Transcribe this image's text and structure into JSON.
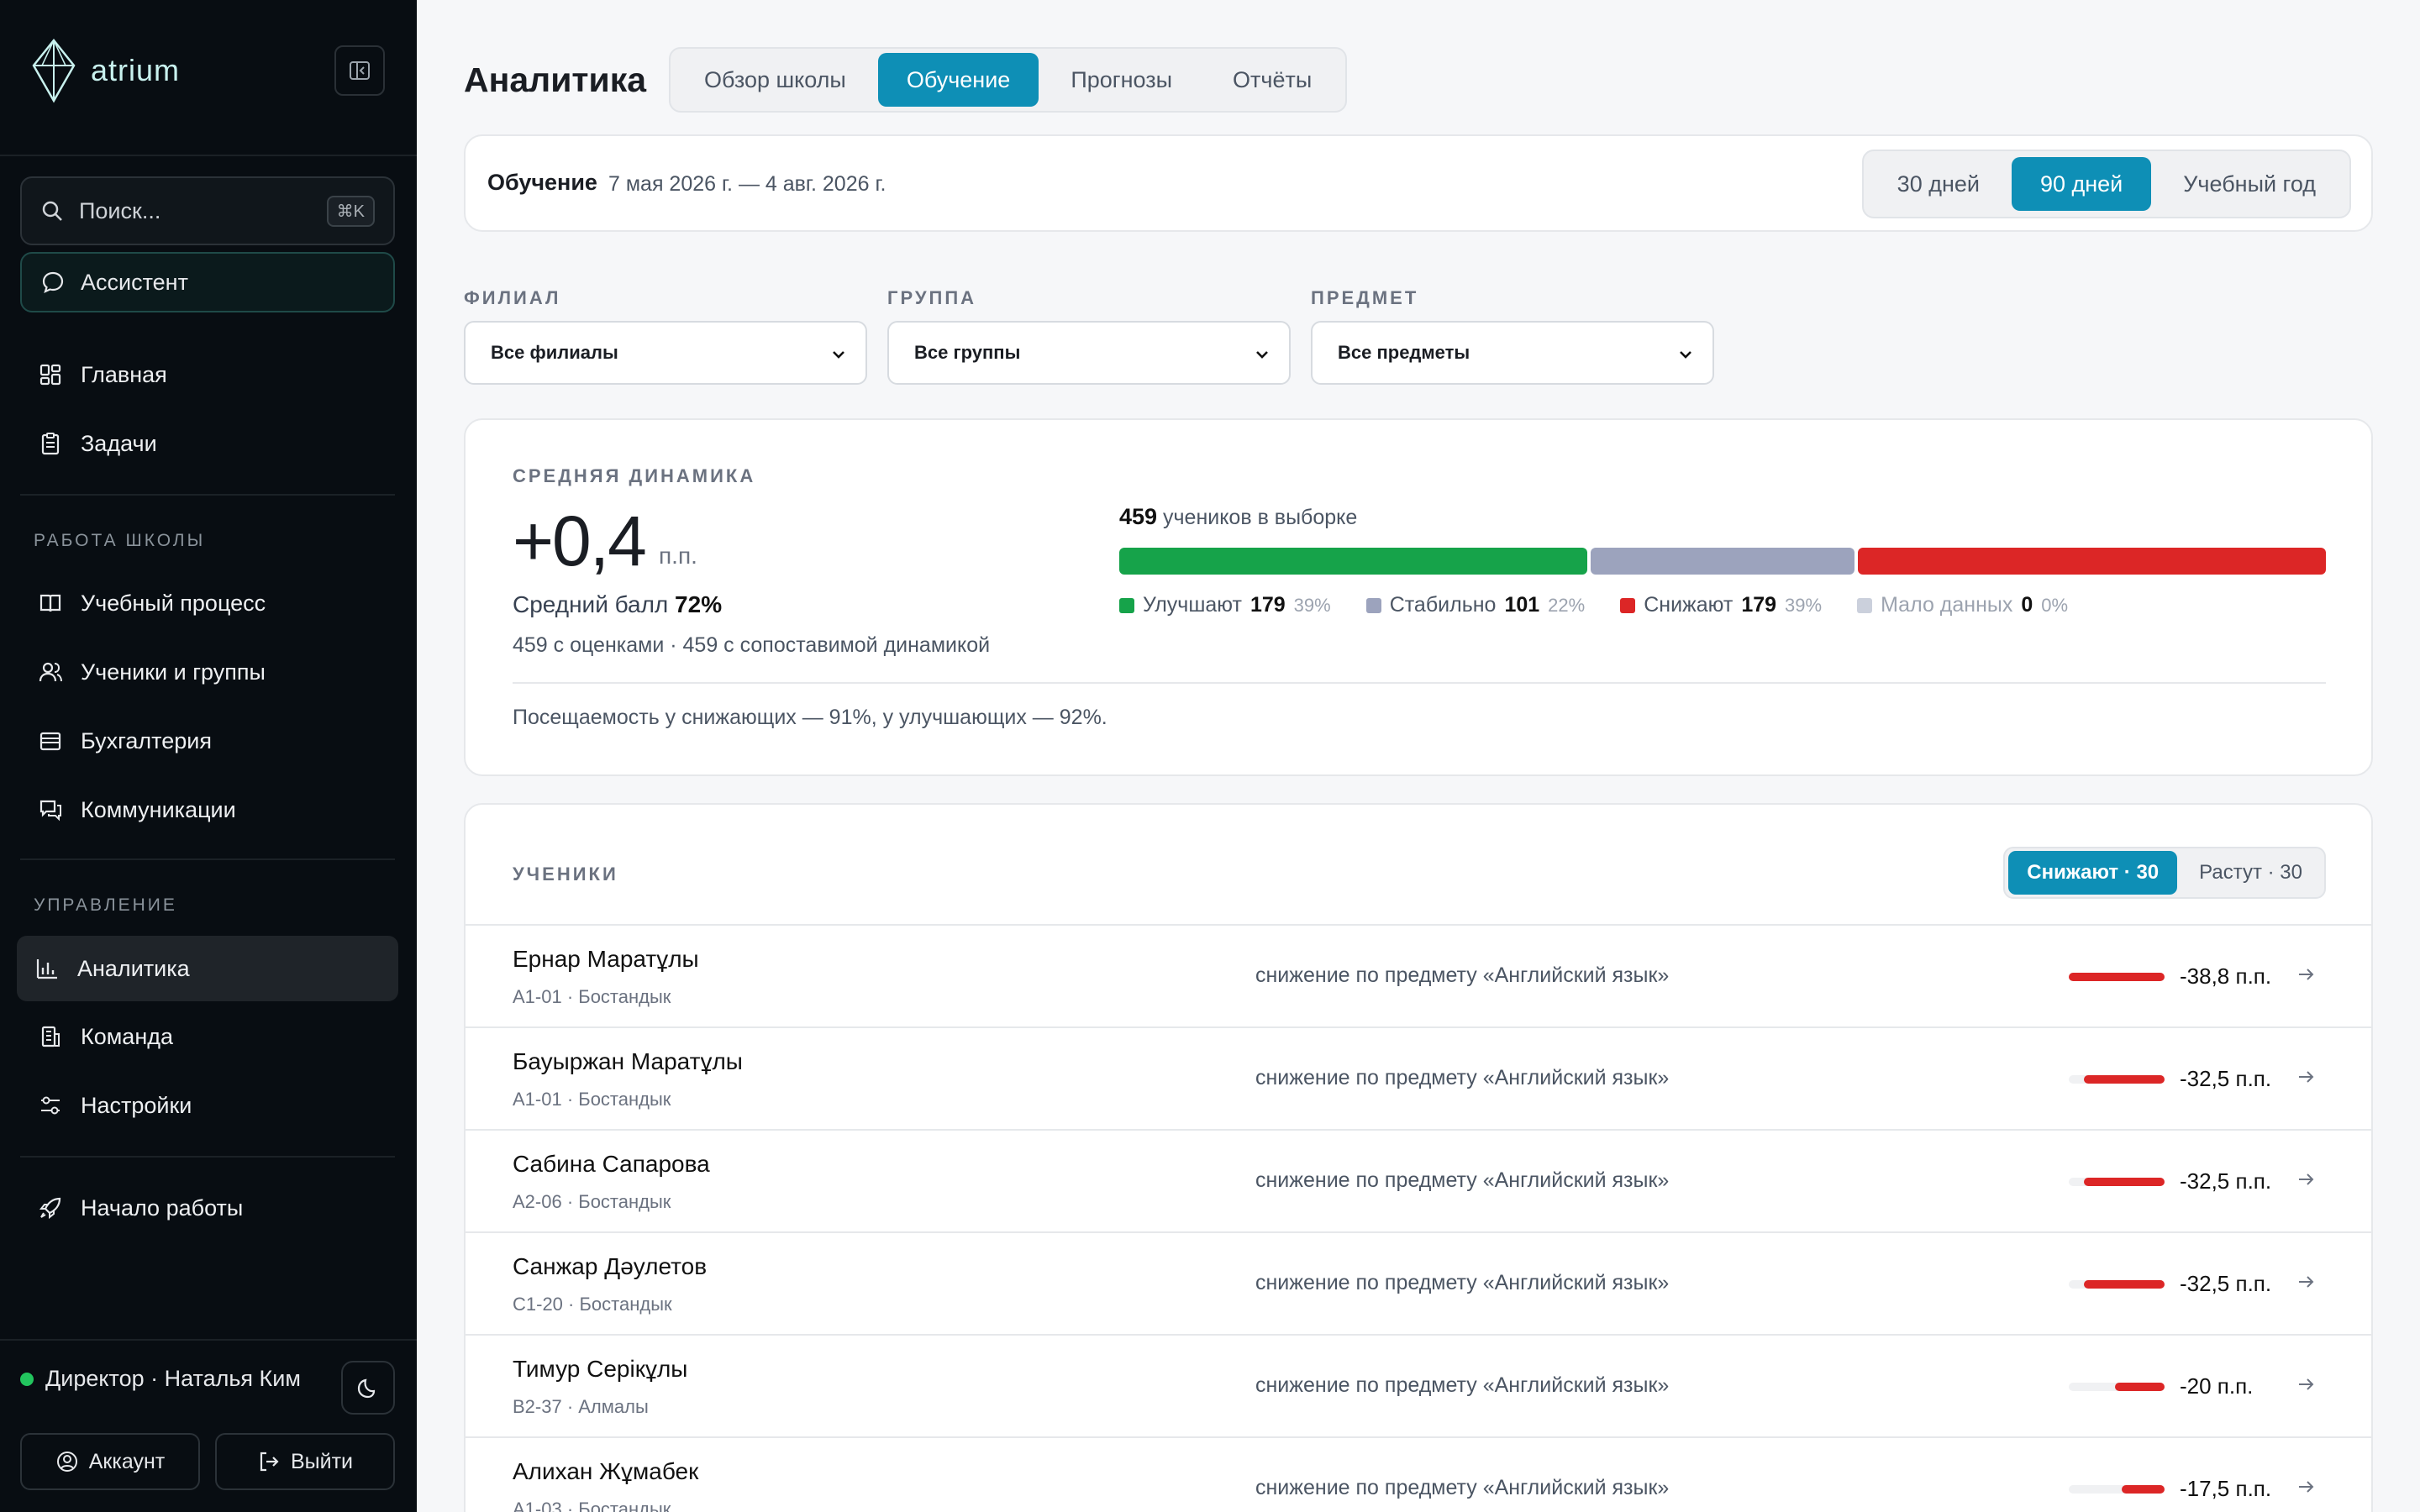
{
  "sidebar": {
    "brand": "atrium",
    "search_placeholder": "Поиск...",
    "search_shortcut": "⌘K",
    "assistant": "Ассистент",
    "top_items": [
      {
        "label": "Главная",
        "icon": "grid-icon"
      },
      {
        "label": "Задачи",
        "icon": "clipboard-icon"
      }
    ],
    "section_work": "РАБОТА ШКОЛЫ",
    "work_items": [
      {
        "label": "Учебный процесс",
        "icon": "book-icon"
      },
      {
        "label": "Ученики и группы",
        "icon": "users-icon"
      },
      {
        "label": "Бухгалтерия",
        "icon": "wallet-icon"
      },
      {
        "label": "Коммуникации",
        "icon": "chat-icon"
      }
    ],
    "section_manage": "УПРАВЛЕНИЕ",
    "manage_items": [
      {
        "label": "Аналитика",
        "icon": "bar-chart-icon",
        "active": true
      },
      {
        "label": "Команда",
        "icon": "building-icon"
      },
      {
        "label": "Настройки",
        "icon": "sliders-icon"
      }
    ],
    "start": "Начало работы",
    "user": "Директор · Наталья Ким",
    "account": "Аккаунт",
    "logout": "Выйти"
  },
  "header": {
    "title": "Аналитика",
    "tabs": [
      "Обзор школы",
      "Обучение",
      "Прогнозы",
      "Отчёты"
    ],
    "active_tab": "Обучение"
  },
  "period": {
    "label": "Обучение",
    "range": "7 мая 2026 г. — 4 авг. 2026 г.",
    "options": [
      "30 дней",
      "90 дней",
      "Учебный год"
    ],
    "active": "90 дней"
  },
  "filters": [
    {
      "label": "ФИЛИАЛ",
      "value": "Все филиалы"
    },
    {
      "label": "ГРУППА",
      "value": "Все группы"
    },
    {
      "label": "ПРЕДМЕТ",
      "value": "Все предметы"
    }
  ],
  "dynamics": {
    "label": "СРЕДНЯЯ ДИНАМИКА",
    "value": "+0,4",
    "unit": "п.п.",
    "avg_label": "Средний балл",
    "avg_value": "72%",
    "counts": "459 с оценками · 459 с сопоставимой динамикой",
    "sample_count": "459",
    "sample_label": "учеников в выборке",
    "segments": [
      {
        "label": "Улучшают",
        "count": "179",
        "pct": "39%",
        "share": 0.39,
        "color": "#16a34a"
      },
      {
        "label": "Стабильно",
        "count": "101",
        "pct": "22%",
        "share": 0.22,
        "color": "#9ca3bd"
      },
      {
        "label": "Снижают",
        "count": "179",
        "pct": "39%",
        "share": 0.39,
        "color": "#dc2626"
      },
      {
        "label": "Мало данных",
        "count": "0",
        "pct": "0%",
        "share": 0,
        "color": "#cbd0dc"
      }
    ],
    "attendance": "Посещаемость у снижающих — 91%, у улучшающих — 92%."
  },
  "students": {
    "label": "УЧЕНИКИ",
    "tabs": [
      "Снижают · 30",
      "Растут · 30"
    ],
    "active_tab": "Снижают · 30",
    "rows": [
      {
        "name": "Ернар Маратұлы",
        "meta": "A1-01 · Бостандык",
        "reason": "снижение по предмету «Английский язык»",
        "delta": "-38,8 п.п.",
        "level": 1.0
      },
      {
        "name": "Бауыржан Маратұлы",
        "meta": "A1-01 · Бостандык",
        "reason": "снижение по предмету «Английский язык»",
        "delta": "-32,5 п.п.",
        "level": 0.84
      },
      {
        "name": "Сабина Сапарова",
        "meta": "A2-06 · Бостандык",
        "reason": "снижение по предмету «Английский язык»",
        "delta": "-32,5 п.п.",
        "level": 0.84
      },
      {
        "name": "Санжар Дәулетов",
        "meta": "C1-20 · Бостандык",
        "reason": "снижение по предмету «Английский язык»",
        "delta": "-32,5 п.п.",
        "level": 0.84
      },
      {
        "name": "Тимур Серікұлы",
        "meta": "B2-37 · Алмалы",
        "reason": "снижение по предмету «Английский язык»",
        "delta": "-20 п.п.",
        "level": 0.52
      },
      {
        "name": "Алихан Жұмабек",
        "meta": "A1-03 · Бостандык",
        "reason": "снижение по предмету «Английский язык»",
        "delta": "-17,5 п.п.",
        "level": 0.45
      }
    ]
  }
}
